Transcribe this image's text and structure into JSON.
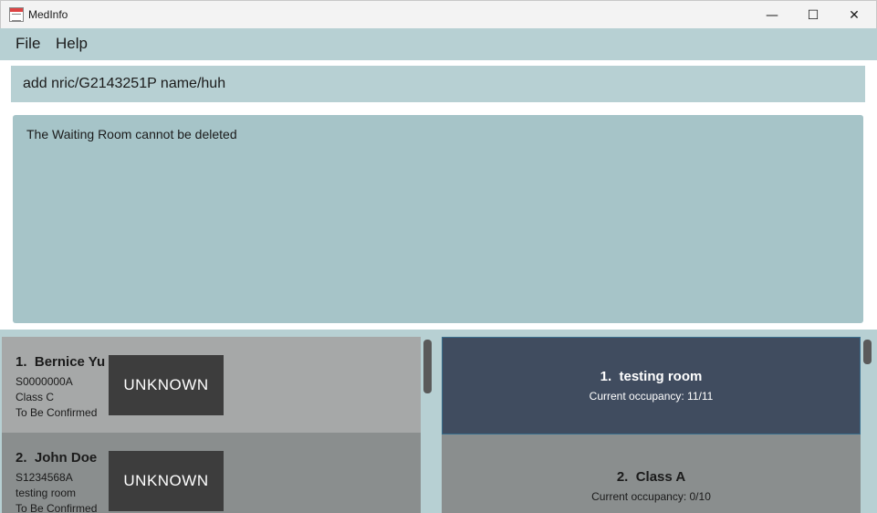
{
  "window": {
    "title": "MedInfo",
    "minimize_glyph": "—",
    "maximize_glyph": "☐",
    "close_glyph": "✕"
  },
  "menu": {
    "file": "File",
    "help": "Help"
  },
  "command": {
    "value": "add nric/G2143251P name/huh"
  },
  "result": {
    "message": "The Waiting Room cannot be deleted"
  },
  "patients": [
    {
      "index": "1.",
      "name": "Bernice Yu",
      "nric": "S0000000A",
      "room": "Class C",
      "status": "To Be Confirmed",
      "tag": "UNKNOWN"
    },
    {
      "index": "2.",
      "name": "John Doe",
      "nric": "S1234568A",
      "room": "testing room",
      "status": "To Be Confirmed",
      "tag": "UNKNOWN"
    }
  ],
  "rooms": [
    {
      "index": "1.",
      "name": "testing room",
      "occupancy": "Current occupancy: 11/11"
    },
    {
      "index": "2.",
      "name": "Class A",
      "occupancy": "Current occupancy: 0/10"
    }
  ],
  "colors": {
    "menu_bg": "#b7d0d3",
    "result_bg": "#a6c4c8",
    "selected_room_bg": "#404c5f",
    "tag_bg": "#3d3d3d"
  }
}
